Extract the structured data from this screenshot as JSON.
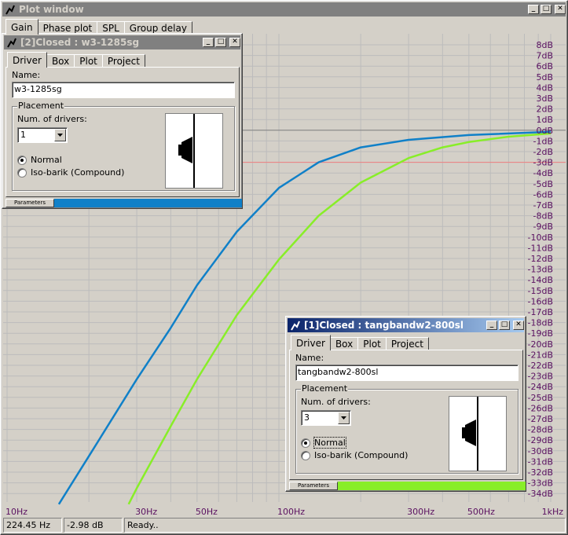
{
  "main_window": {
    "title": "Plot window"
  },
  "main_tabs": [
    "Gain",
    "Phase plot",
    "SPL",
    "Group delay"
  ],
  "chart_data": {
    "type": "line",
    "x_scale": "log",
    "xlim": [
      10,
      1000
    ],
    "ylim": [
      -35,
      8.5
    ],
    "x_ticks": [
      {
        "v": 10,
        "label": "10Hz"
      },
      {
        "v": 30,
        "label": "30Hz"
      },
      {
        "v": 50,
        "label": "50Hz"
      },
      {
        "v": 100,
        "label": "100Hz"
      },
      {
        "v": 300,
        "label": "300Hz"
      },
      {
        "v": 500,
        "label": "500Hz"
      },
      {
        "v": 1000,
        "label": "1kHz"
      }
    ],
    "y_ticks": [
      "8dB",
      "7dB",
      "6dB",
      "5dB",
      "4dB",
      "3dB",
      "2dB",
      "1dB",
      "0dB",
      "-1dB",
      "-2dB",
      "-3dB",
      "-4dB",
      "-5dB",
      "-6dB",
      "-7dB",
      "-8dB",
      "-9dB",
      "-10dB",
      "-11dB",
      "-12dB",
      "-13dB",
      "-14dB",
      "-15dB",
      "-16dB",
      "-17dB",
      "-18dB",
      "-19dB",
      "-20dB",
      "-21dB",
      "-22dB",
      "-23dB",
      "-24dB",
      "-25dB",
      "-26dB",
      "-27dB",
      "-28dB",
      "-29dB",
      "-30dB",
      "-31dB",
      "-32dB",
      "-33dB",
      "-34dB"
    ],
    "reference_lines": [
      {
        "y": 0,
        "color": "#808080"
      },
      {
        "y": -3,
        "color": "#f08080"
      }
    ],
    "grid": true,
    "series": [
      {
        "color": "#1080c8",
        "points": [
          [
            15.5,
            -35
          ],
          [
            20,
            -30.5
          ],
          [
            30,
            -23.3
          ],
          [
            40,
            -18.5
          ],
          [
            50,
            -14.5
          ],
          [
            70,
            -9.5
          ],
          [
            100,
            -5.4
          ],
          [
            140,
            -3
          ],
          [
            200,
            -1.6
          ],
          [
            300,
            -0.9
          ],
          [
            500,
            -0.45
          ],
          [
            1000,
            -0.15
          ]
        ]
      },
      {
        "color": "#88ee28",
        "points": [
          [
            28,
            -35
          ],
          [
            30,
            -33.5
          ],
          [
            40,
            -27.7
          ],
          [
            50,
            -23.3
          ],
          [
            70,
            -17.3
          ],
          [
            100,
            -12.1
          ],
          [
            140,
            -8
          ],
          [
            200,
            -4.9
          ],
          [
            300,
            -2.6
          ],
          [
            400,
            -1.6
          ],
          [
            500,
            -1.1
          ],
          [
            700,
            -0.6
          ],
          [
            1000,
            -0.3
          ]
        ]
      }
    ]
  },
  "status_bar": {
    "frequency": "224.45 Hz",
    "gain": "-2.98 dB",
    "message": "Ready.."
  },
  "driver_windows": [
    {
      "title": "[2]Closed : w3-1285sg",
      "tabs": [
        "Driver",
        "Box",
        "Plot",
        "Project"
      ],
      "name_label": "Name:",
      "name_value": "w3-1285sg",
      "placement_label": "Placement",
      "num_drivers_label": "Num. of drivers:",
      "num_drivers_value": "1",
      "radio_normal": "Normal",
      "radio_isobarik": "Iso-barik (Compound)",
      "selected_placement": "Normal",
      "parameters_label": "Parameters",
      "bar_color": "#1080c8"
    },
    {
      "title": "[1]Closed : tangbandw2-800sl",
      "tabs": [
        "Driver",
        "Box",
        "Plot",
        "Project"
      ],
      "name_label": "Name:",
      "name_value": "tangbandw2-800sl",
      "placement_label": "Placement",
      "num_drivers_label": "Num. of drivers:",
      "num_drivers_value": "3",
      "radio_normal": "Normal",
      "radio_isobarik": "Iso-barik (Compound)",
      "selected_placement": "Normal",
      "parameters_label": "Parameters",
      "bar_color": "#88ee28"
    }
  ]
}
